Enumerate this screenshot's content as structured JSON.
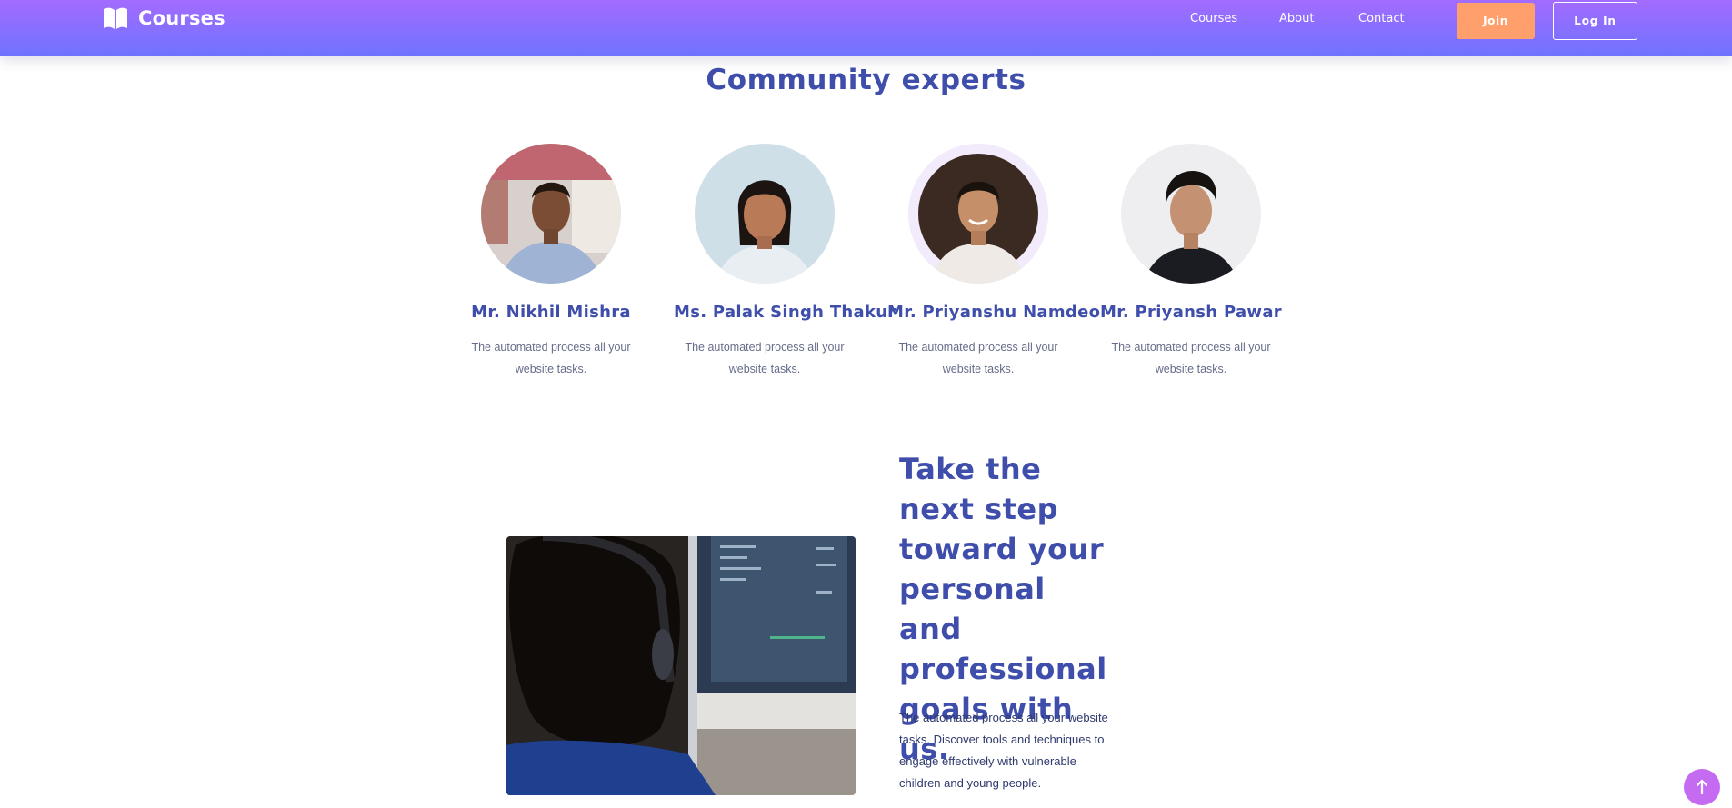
{
  "header": {
    "brand": "Courses",
    "brand_icon": "open-book-icon",
    "nav": [
      "Courses",
      "About",
      "Contact"
    ],
    "join_label": "Join",
    "login_label": "Log In",
    "gradient": [
      "#a36bff",
      "#6f73ff"
    ],
    "join_color": "#ff9f6b"
  },
  "experts_section": {
    "title": "Community experts",
    "experts": [
      {
        "name": "Mr. Nikhil Mishra",
        "desc": "The automated process all your website tasks."
      },
      {
        "name": "Ms. Palak Singh Thakur",
        "desc": "The automated process all your website tasks."
      },
      {
        "name": "Mr. Priyanshu Namdeo",
        "desc": "The automated process all your website tasks."
      },
      {
        "name": "Mr. Priyansh Pawar",
        "desc": "The automated process all your website tasks."
      }
    ]
  },
  "cta_section": {
    "title": "Take the next step toward your personal and professional goals with us.",
    "text": "The automated process all your website tasks. Discover tools and techniques to engage effectively with vulnerable children and young people."
  },
  "scroll_top_icon": "arrow-up-icon"
}
